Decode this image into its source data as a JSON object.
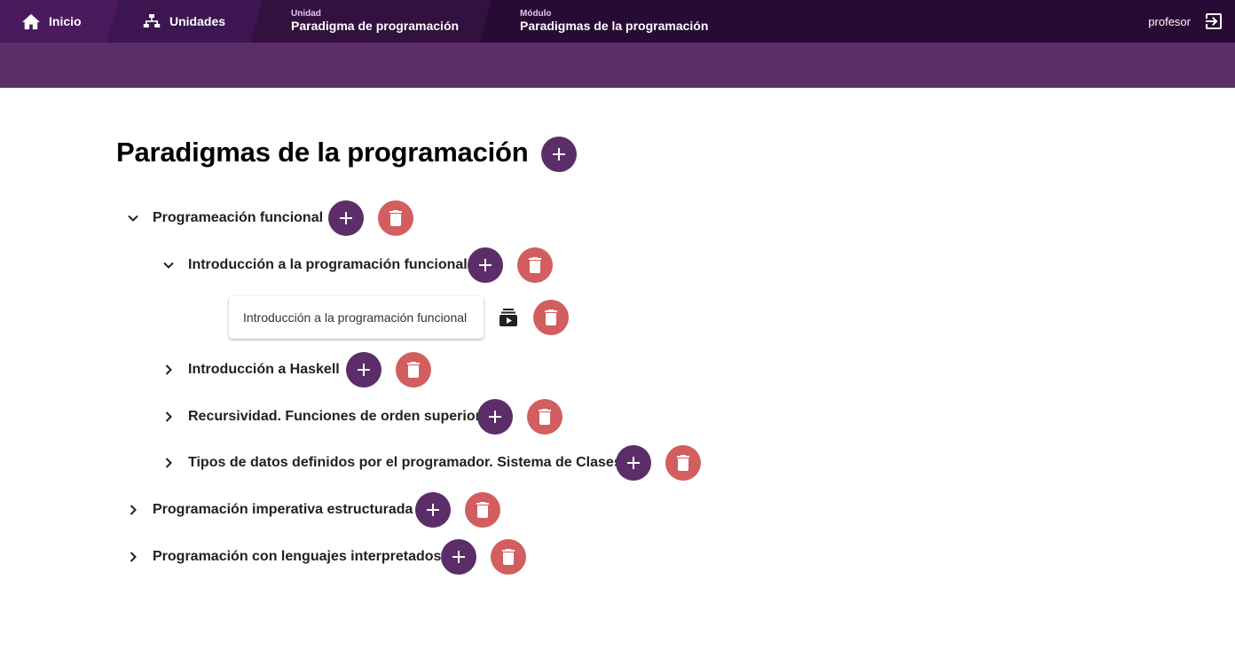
{
  "nav": {
    "home_label": "Inicio",
    "units_label": "Unidades",
    "unit_caption": "Unidad",
    "unit_name": "Paradigma de programación",
    "module_caption": "Módulo",
    "module_name": "Paradigmas de la programación",
    "user": "profesor",
    "icons": {
      "home": "home-icon",
      "units": "sitemap-icon",
      "logout": "logout-icon"
    }
  },
  "page": {
    "title": "Paradigmas de la programación"
  },
  "tree": {
    "topic1": {
      "label": "Programeación funcional",
      "expanded": true,
      "sub1": {
        "label": "Introducción a la programación funcional",
        "expanded": true,
        "lesson": {
          "label": "Introducción a la programación funcional",
          "icon": "video-library-icon"
        }
      },
      "sub2": {
        "label": "Introducción a Haskell",
        "expanded": false
      },
      "sub3": {
        "label": "Recursividad. Funciones de orden superior",
        "expanded": false
      },
      "sub4": {
        "label": "Tipos de datos definidos por el programador. Sistema de Clases",
        "expanded": false
      }
    },
    "topic2": {
      "label": "Programación imperativa estructurada",
      "expanded": false
    },
    "topic3": {
      "label": "Programación con lenguajes interpretados",
      "expanded": false
    }
  },
  "colors": {
    "nav_background": "#24082e",
    "header_band": "#5b2d69",
    "add_button": "#5b2d69",
    "delete_button": "#d25e5f"
  }
}
